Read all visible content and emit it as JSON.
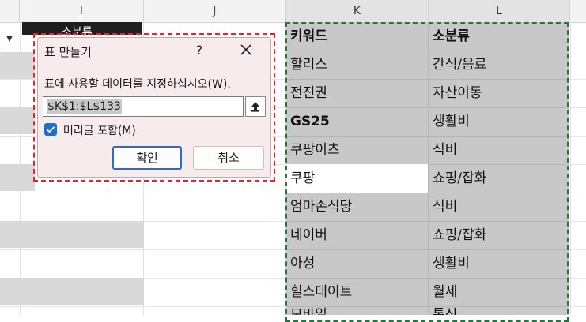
{
  "columns": [
    {
      "label": "I",
      "selected": false
    },
    {
      "label": "J",
      "selected": false
    },
    {
      "label": "K",
      "selected": true
    },
    {
      "label": "L",
      "selected": true
    }
  ],
  "partial_header": "소분류",
  "table": {
    "rows": [
      {
        "keyword": "키워드",
        "category": "소분류"
      },
      {
        "keyword": "할리스",
        "category": "간식/음료"
      },
      {
        "keyword": "전진권",
        "category": "자산이동"
      },
      {
        "keyword": "GS25",
        "category": "생활비"
      },
      {
        "keyword": "쿠팡이츠",
        "category": "식비"
      },
      {
        "keyword": "쿠팡",
        "category": "쇼핑/잡화"
      },
      {
        "keyword": "엄마손식당",
        "category": "식비"
      },
      {
        "keyword": "네이버",
        "category": "쇼핑/잡화"
      },
      {
        "keyword": "아성",
        "category": "생활비"
      },
      {
        "keyword": "힐스테이트",
        "category": "월세"
      },
      {
        "keyword": "모바일",
        "category": "통신"
      }
    ]
  },
  "dialog": {
    "title": "표 만들기",
    "help": "?",
    "prompt": "표에 사용할 데이터를 지정하십시오(W).",
    "range": "$K$1:$L$133",
    "header_checkbox": "머리글 포함(M)",
    "header_checked": true,
    "ok": "확인",
    "cancel": "취소"
  },
  "colors": {
    "accent": "#1f6fc8",
    "marching_ants": "#1e7a3a",
    "highlight_outline": "#e0262e"
  }
}
